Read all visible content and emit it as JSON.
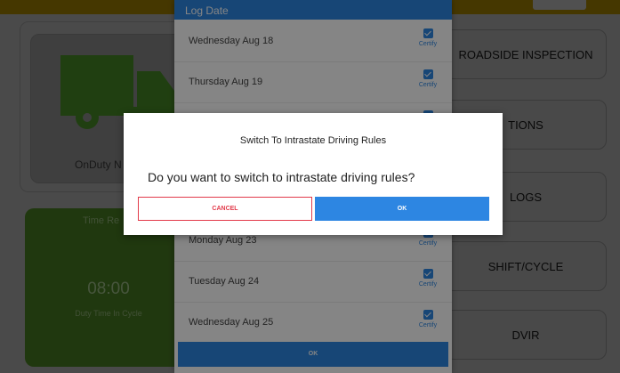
{
  "background": {
    "status_label": "OnDuty N",
    "time_card": {
      "heading": "Time Re",
      "time": "08:00",
      "subtitle": "Duty Time In Cycle"
    },
    "buttons": [
      "ROADSIDE INSPECTION",
      "TIONS",
      "LOGS",
      "SHIFT/CYCLE",
      "DVIR"
    ]
  },
  "log_dialog": {
    "header": "Log Date",
    "rows": [
      {
        "date": "Wednesday Aug 18",
        "action": "Certify"
      },
      {
        "date": "Thursday Aug 19",
        "action": "Certify"
      },
      {
        "date": "",
        "action": ""
      },
      {
        "date": "",
        "action": ""
      },
      {
        "date": "",
        "action": ""
      },
      {
        "date": "Monday Aug 23",
        "action": "Certify"
      },
      {
        "date": "Tuesday Aug 24",
        "action": "Certify"
      },
      {
        "date": "Wednesday Aug 25",
        "action": "Certify"
      }
    ],
    "ok_label": "OK"
  },
  "confirm_dialog": {
    "title": "Switch To Intrastate Driving Rules",
    "message": "Do you want to switch to intrastate driving rules?",
    "cancel_label": "CANCEL",
    "ok_label": "OK"
  },
  "colors": {
    "accent": "#2d86e2",
    "cancel": "#e23a4a",
    "topbar": "#856a00"
  }
}
